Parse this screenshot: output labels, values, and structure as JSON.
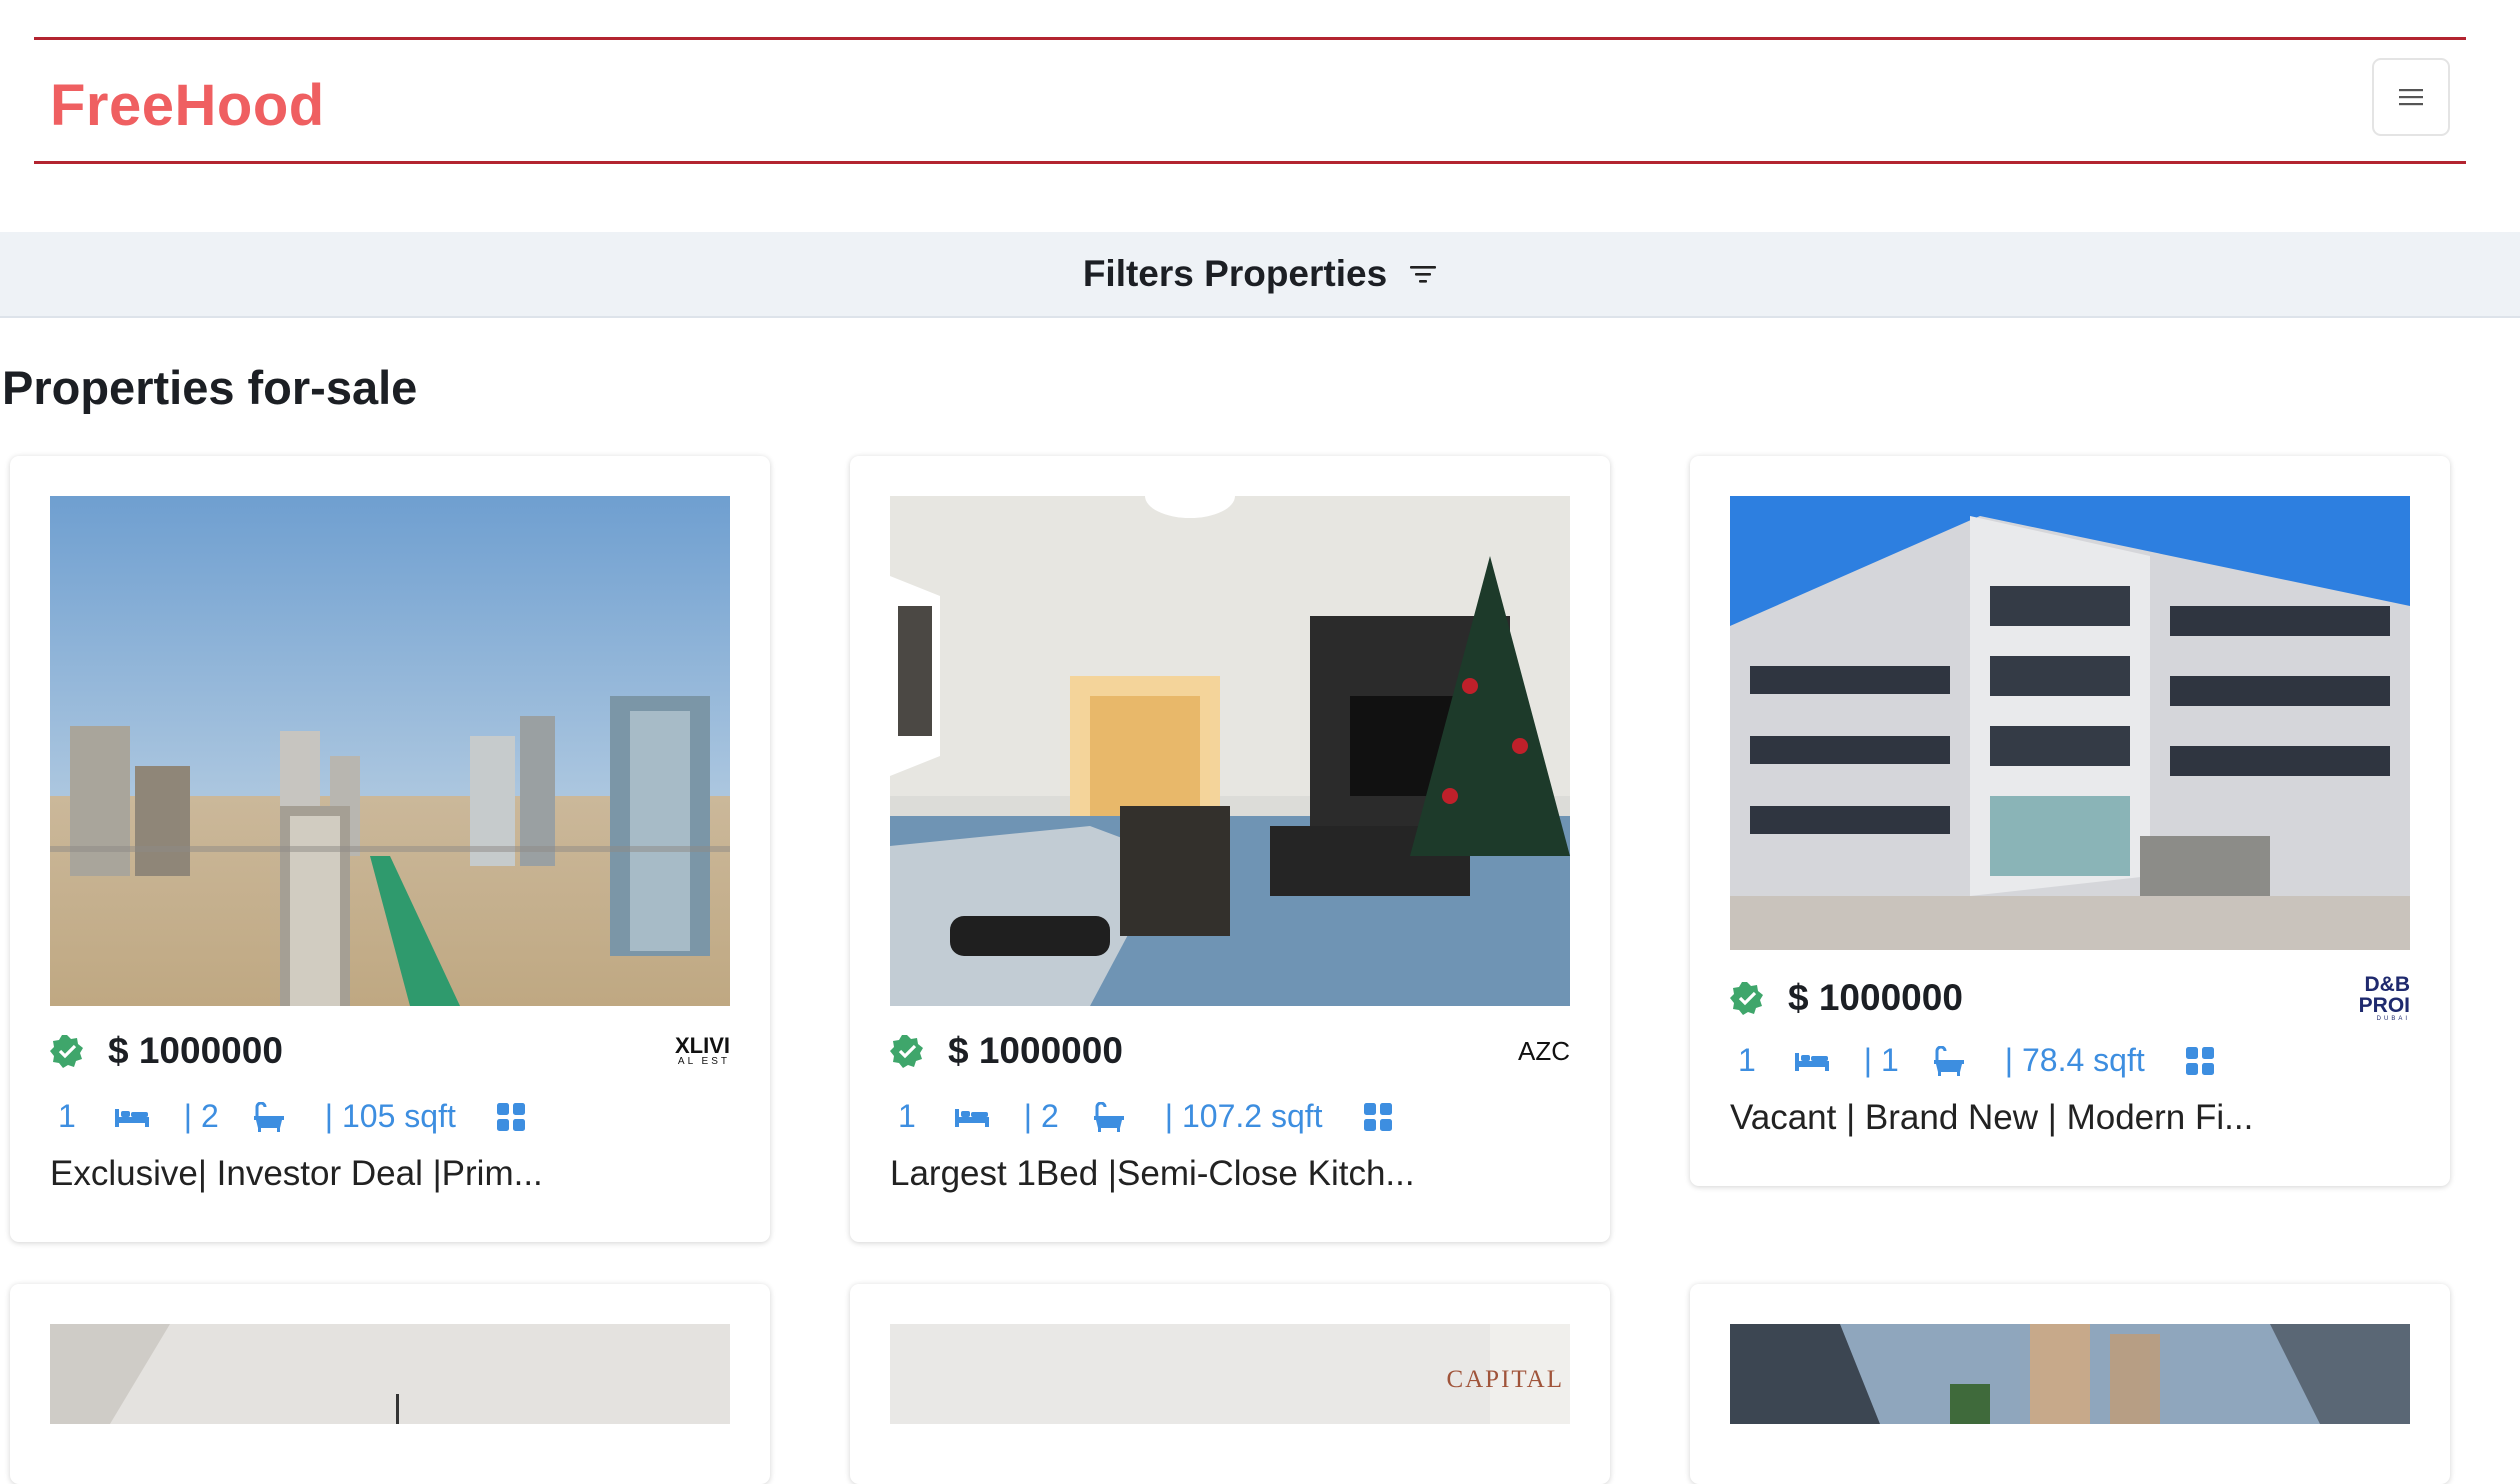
{
  "header": {
    "brand": "FreeHood",
    "menu_icon": "hamburger-icon"
  },
  "filters": {
    "label": "Filters Properties",
    "icon": "filter-lines-icon"
  },
  "page_title": "Properties for-sale",
  "colors": {
    "brand": "#ef5f61",
    "rule": "#b32430",
    "accent": "#3d8ee0",
    "verified": "#3fa66b"
  },
  "listings": [
    {
      "price": "$ 1000000",
      "beds": "1",
      "baths": "| 2",
      "area": "| 105 sqft",
      "title": "Exclusive| Investor Deal |Prim...",
      "agency": "XLIVI",
      "agency_sub": "AL EST"
    },
    {
      "price": "$ 1000000",
      "beds": "1",
      "baths": "| 2",
      "area": "| 107.2 sqft",
      "title": "Largest 1Bed |Semi-Close Kitch...",
      "agency": "AZC",
      "agency_sub": ""
    },
    {
      "price": "$ 1000000",
      "beds": "1",
      "baths": "| 1",
      "area": "| 78.4 sqft",
      "title": "Vacant | Brand New | Modern Fi...",
      "agency": "D&B PROI",
      "agency_sub": "DUBAI"
    }
  ],
  "next_row": [
    {
      "agency": ""
    },
    {
      "agency": "CAPITAL"
    },
    {
      "agency": ""
    }
  ]
}
